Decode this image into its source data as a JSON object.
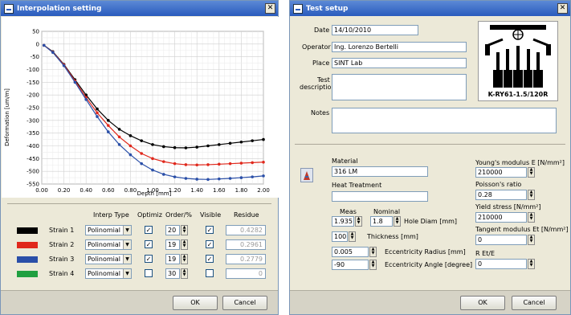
{
  "interp": {
    "title": "Interpolation setting",
    "chart_data": {
      "type": "line",
      "xlabel": "Depth [mm]",
      "ylabel": "Deformation [um/m]",
      "xlim": [
        0,
        2
      ],
      "ylim": [
        -550,
        50
      ],
      "xticks": [
        "0.00",
        "0.20",
        "0.40",
        "0.60",
        "0.80",
        "1.00",
        "1.20",
        "1.40",
        "1.60",
        "1.80",
        "2.00"
      ],
      "yticks": [
        "50",
        "0",
        "-50",
        "-100",
        "-150",
        "-200",
        "-250",
        "-300",
        "-350",
        "-400",
        "-450",
        "-500",
        "-550"
      ],
      "grid": true,
      "series": [
        {
          "name": "Strain 1",
          "color": "#000000",
          "x": [
            0.02,
            0.1,
            0.2,
            0.3,
            0.4,
            0.5,
            0.6,
            0.7,
            0.8,
            0.9,
            1.0,
            1.1,
            1.2,
            1.3,
            1.4,
            1.5,
            1.6,
            1.7,
            1.8,
            1.9,
            2.0
          ],
          "y": [
            -5,
            -30,
            -80,
            -140,
            -200,
            -255,
            -300,
            -335,
            -360,
            -380,
            -395,
            -403,
            -407,
            -408,
            -405,
            -400,
            -395,
            -390,
            -385,
            -380,
            -375
          ]
        },
        {
          "name": "Strain 2",
          "color": "#e0281c",
          "x": [
            0.02,
            0.1,
            0.2,
            0.3,
            0.4,
            0.5,
            0.6,
            0.7,
            0.8,
            0.9,
            1.0,
            1.1,
            1.2,
            1.3,
            1.4,
            1.5,
            1.6,
            1.7,
            1.8,
            1.9,
            2.0
          ],
          "y": [
            -5,
            -32,
            -82,
            -145,
            -210,
            -270,
            -320,
            -365,
            -400,
            -430,
            -450,
            -462,
            -470,
            -474,
            -475,
            -474,
            -472,
            -470,
            -468,
            -466,
            -464
          ]
        },
        {
          "name": "Strain 3",
          "color": "#2a4fa8",
          "x": [
            0.02,
            0.1,
            0.2,
            0.3,
            0.4,
            0.5,
            0.6,
            0.7,
            0.8,
            0.9,
            1.0,
            1.1,
            1.2,
            1.3,
            1.4,
            1.5,
            1.6,
            1.7,
            1.8,
            1.9,
            2.0
          ],
          "y": [
            -5,
            -33,
            -85,
            -150,
            -218,
            -285,
            -345,
            -395,
            -435,
            -470,
            -495,
            -512,
            -522,
            -528,
            -531,
            -532,
            -530,
            -528,
            -525,
            -522,
            -518
          ]
        }
      ]
    },
    "table_headers": {
      "interp": "Interp Type",
      "optim": "Optimiz",
      "order": "Order/%",
      "visible": "Visible",
      "residue": "Residue"
    },
    "rows": [
      {
        "name": "Strain 1",
        "color": "#000000",
        "type": "Polinomial",
        "optim": "✓",
        "order": "20",
        "visible": "✓",
        "residue": "0.4282"
      },
      {
        "name": "Strain 2",
        "color": "#e0281c",
        "type": "Polinomial",
        "optim": "✓",
        "order": "19",
        "visible": "✓",
        "residue": "0.2961"
      },
      {
        "name": "Strain 3",
        "color": "#2a4fa8",
        "type": "Polinomial",
        "optim": "✓",
        "order": "19",
        "visible": "✓",
        "residue": "0.2779"
      },
      {
        "name": "Strain 4",
        "color": "#20a040",
        "type": "Polinomial",
        "optim": "",
        "order": "30",
        "visible": "",
        "residue": "0"
      }
    ],
    "ok": "OK",
    "cancel": "Cancel"
  },
  "setup": {
    "title": "Test setup",
    "date_label": "Date",
    "date": "14/10/2010",
    "operator_label": "Operator",
    "operator": "Ing. Lorenzo Bertelli",
    "place_label": "Place",
    "place": "SINT Lab",
    "desc_label_1": "Test",
    "desc_label_2": "description",
    "notes_label": "Notes",
    "gauge_name": "K-RY61-1.5/120R",
    "material_label": "Material",
    "material": "316 LM",
    "heat_label": "Heat Treatment",
    "meas_label": "Meas",
    "nominal_label": "Nominal",
    "hole_meas": "1.935",
    "hole_nominal": "1.8",
    "hole_label": "Hole Diam [mm]",
    "thickness": "100",
    "thickness_label": "Thickness [mm]",
    "ecc_radius": "0.005",
    "ecc_radius_label": "Eccentricity Radius [mm]",
    "ecc_angle": "-90",
    "ecc_angle_label": "Eccentricity Angle [degree]",
    "young_label": "Young's modulus E [N/mm²]",
    "young": "210000",
    "poisson_label": "Poisson's ratio",
    "poisson": "0.28",
    "yield_label": "Yield stress [N/mm²]",
    "yield": "210000",
    "tangent_label": "Tangent modulus Et [N/mm²]",
    "tangent": "0",
    "ret_label": "R Et/E",
    "ret": "0",
    "ok": "OK",
    "cancel": "Cancel"
  }
}
